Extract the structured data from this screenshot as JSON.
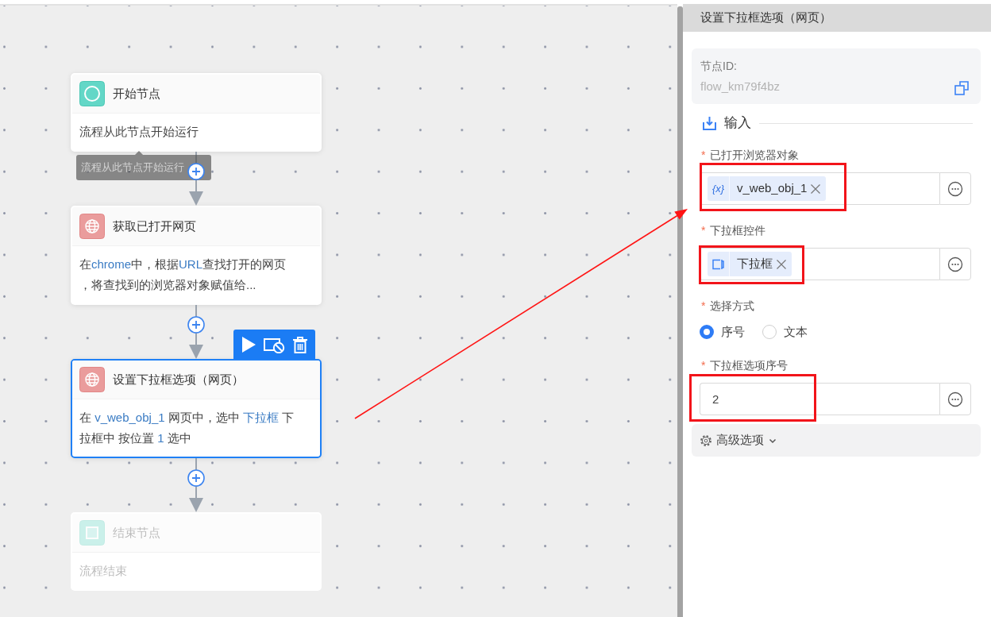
{
  "canvas": {
    "nodes": [
      {
        "kind": "start",
        "title": "开始节点",
        "selected": false,
        "faded": false,
        "description": [
          [
            {
              "kind": "plain",
              "text": "流程从此节点开始运行"
            }
          ]
        ],
        "tooltip": "流程从此节点开始运行"
      },
      {
        "kind": "web",
        "title": "获取已打开网页",
        "selected": false,
        "faded": false,
        "description": [
          [
            {
              "kind": "plain",
              "text": "在"
            },
            {
              "kind": "var",
              "text": "chrome"
            },
            {
              "kind": "plain",
              "text": "中，根据"
            },
            {
              "kind": "var",
              "text": "URL"
            },
            {
              "kind": "plain",
              "text": "查找打开的网页"
            }
          ],
          [
            {
              "kind": "plain",
              "text": "，将查找到的浏览器对象赋值给..."
            }
          ]
        ]
      },
      {
        "kind": "web",
        "title": "设置下拉框选项（网页）",
        "selected": true,
        "faded": false,
        "description": [
          [
            {
              "kind": "plain",
              "text": "在 "
            },
            {
              "kind": "var",
              "text": "v_web_obj_1"
            },
            {
              "kind": "plain",
              "text": " 网页中，选中 "
            },
            {
              "kind": "var",
              "text": "下拉框"
            },
            {
              "kind": "plain",
              "text": " 下"
            }
          ],
          [
            {
              "kind": "plain",
              "text": "拉框中 按位置 "
            },
            {
              "kind": "var",
              "text": "1"
            },
            {
              "kind": "plain",
              "text": " 选中"
            }
          ]
        ]
      },
      {
        "kind": "end",
        "title": "结束节点",
        "selected": false,
        "faded": true,
        "description": [
          [
            {
              "kind": "plain",
              "text": "流程结束"
            }
          ]
        ]
      }
    ]
  },
  "panel": {
    "title": "设置下拉框选项（网页）",
    "node_id_label": "节点ID:",
    "node_id": "flow_km79f4bz",
    "section_title": "输入",
    "fields": [
      {
        "kind": "chips",
        "required_mark": "*",
        "label": "已打开浏览器对象",
        "highlighted": true,
        "chips": [
          {
            "kind": "variable",
            "icon": "{x}",
            "text": "v_web_obj_1"
          }
        ]
      },
      {
        "kind": "chips",
        "required_mark": "*",
        "label": "下拉框控件",
        "highlighted": true,
        "chips": [
          {
            "kind": "element",
            "text": "下拉框"
          }
        ]
      },
      {
        "kind": "radio",
        "required_mark": "*",
        "label": "选择方式",
        "highlighted": false,
        "options": [
          {
            "label": "序号",
            "selected": true
          },
          {
            "label": "文本",
            "selected": false
          }
        ]
      },
      {
        "kind": "text",
        "required_mark": "*",
        "label": "下拉框选项序号",
        "highlighted": true,
        "value": "2"
      }
    ],
    "advanced": {
      "label": "高级选项",
      "expanded": false
    }
  }
}
